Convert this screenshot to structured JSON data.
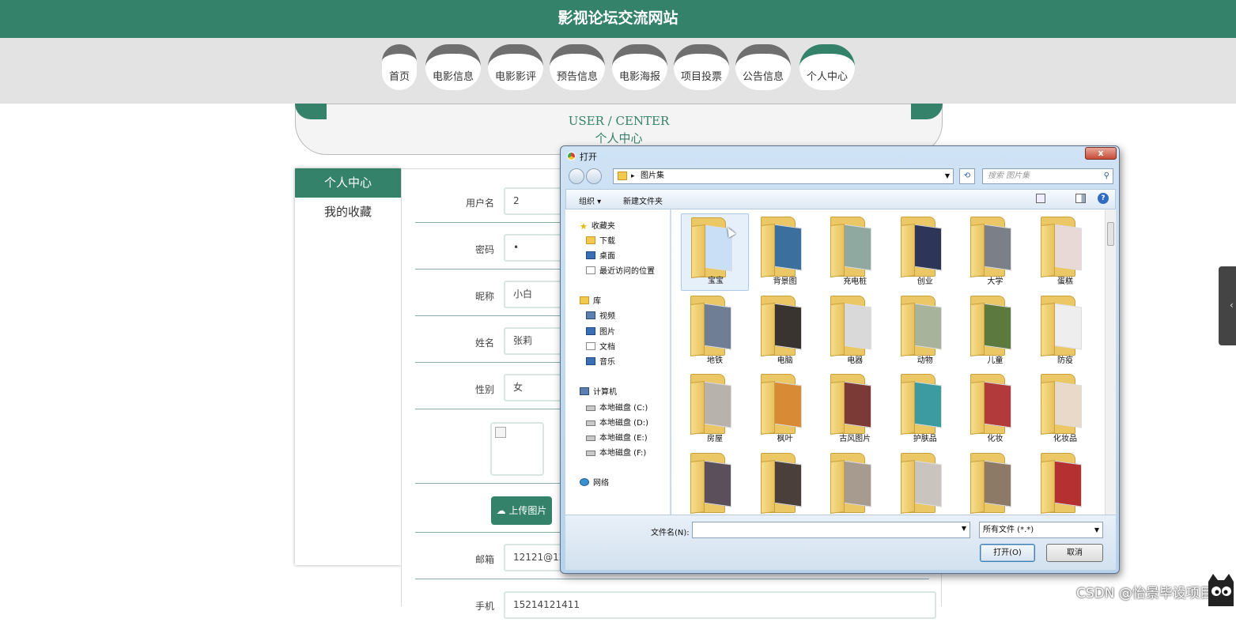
{
  "site": {
    "title": "影视论坛交流网站"
  },
  "nav": {
    "items": [
      {
        "label": "首页"
      },
      {
        "label": "电影信息"
      },
      {
        "label": "电影影评"
      },
      {
        "label": "预告信息"
      },
      {
        "label": "电影海报"
      },
      {
        "label": "项目投票"
      },
      {
        "label": "公告信息"
      },
      {
        "label": "个人中心"
      }
    ],
    "active_index": 7,
    "active_color": "#35826a"
  },
  "banner": {
    "en": "USER / CENTER",
    "cn": "个人中心"
  },
  "sidebar": {
    "heading": "个人中心",
    "links": [
      "我的收藏"
    ]
  },
  "form": {
    "fields": [
      {
        "label": "用户名",
        "value": "2"
      },
      {
        "label": "密码",
        "value": "•"
      },
      {
        "label": "昵称",
        "value": "小白"
      },
      {
        "label": "姓名",
        "value": "张莉"
      },
      {
        "label": "性别",
        "value": "女"
      },
      {
        "label": "邮箱",
        "value": "12121@12.com"
      },
      {
        "label": "手机",
        "value": "15214121411"
      }
    ],
    "upload_button": "上传图片",
    "upload_icon": "cloud-upload-icon"
  },
  "dialog": {
    "title": "打开",
    "close_glyph": "x",
    "address": {
      "folder": "图片集"
    },
    "search_placeholder": "搜索 图片集",
    "toolbar": {
      "organize": "组织 ▾",
      "new_folder": "新建文件夹"
    },
    "tree": [
      {
        "label": "收藏夹",
        "icon": "star-icon",
        "level": 0
      },
      {
        "label": "下载",
        "icon": "folder-icon",
        "level": 1
      },
      {
        "label": "桌面",
        "icon": "desktop-icon",
        "level": 1
      },
      {
        "label": "最近访问的位置",
        "icon": "recent-icon",
        "level": 1
      },
      {
        "label": "库",
        "icon": "library-icon",
        "level": 0
      },
      {
        "label": "视频",
        "icon": "video-icon",
        "level": 1
      },
      {
        "label": "图片",
        "icon": "picture-icon",
        "level": 1
      },
      {
        "label": "文档",
        "icon": "document-icon",
        "level": 1
      },
      {
        "label": "音乐",
        "icon": "music-icon",
        "level": 1
      },
      {
        "label": "计算机",
        "icon": "computer-icon",
        "level": 0
      },
      {
        "label": "本地磁盘 (C:)",
        "icon": "disk-icon",
        "level": 1
      },
      {
        "label": "本地磁盘 (D:)",
        "icon": "disk-icon",
        "level": 1
      },
      {
        "label": "本地磁盘 (E:)",
        "icon": "disk-icon",
        "level": 1
      },
      {
        "label": "本地磁盘 (F:)",
        "icon": "disk-icon",
        "level": 1
      },
      {
        "label": "网络",
        "icon": "network-icon",
        "level": 0
      }
    ],
    "folders": [
      {
        "name": "宝宝",
        "color": "#c9dff5",
        "selected": true
      },
      {
        "name": "背景图",
        "color": "#3b6f9e"
      },
      {
        "name": "充电桩",
        "color": "#8fa9a0"
      },
      {
        "name": "创业",
        "color": "#2d3558"
      },
      {
        "name": "大学",
        "color": "#7a7f88"
      },
      {
        "name": "蛋糕",
        "color": "#e8d9d6"
      },
      {
        "name": "地铁",
        "color": "#6f7e95"
      },
      {
        "name": "电脑",
        "color": "#3a3430"
      },
      {
        "name": "电器",
        "color": "#d9d9d9"
      },
      {
        "name": "动物",
        "color": "#a7b39a"
      },
      {
        "name": "儿童",
        "color": "#5c7a3d"
      },
      {
        "name": "防疫",
        "color": "#eeeeee"
      },
      {
        "name": "房屋",
        "color": "#b7b2ac"
      },
      {
        "name": "枫叶",
        "color": "#d98a34"
      },
      {
        "name": "古风图片",
        "color": "#7b3a35"
      },
      {
        "name": "护肤品",
        "color": "#3b9ba0"
      },
      {
        "name": "化妆",
        "color": "#b23a3a"
      },
      {
        "name": "化妆品",
        "color": "#e9d9c8"
      },
      {
        "name": "",
        "color": "#5a4f5a"
      },
      {
        "name": "",
        "color": "#4a3f3a"
      },
      {
        "name": "",
        "color": "#a79a8f"
      },
      {
        "name": "",
        "color": "#c9c4bd"
      },
      {
        "name": "",
        "color": "#8d7a66"
      },
      {
        "name": "",
        "color": "#b53030"
      }
    ],
    "filename_label": "文件名(N):",
    "filename_value": "",
    "filetype": "所有文件 (*.*)",
    "open_button": "打开(O)",
    "cancel_button": "取消"
  },
  "watermark": "CSDN @怡景毕设项目"
}
